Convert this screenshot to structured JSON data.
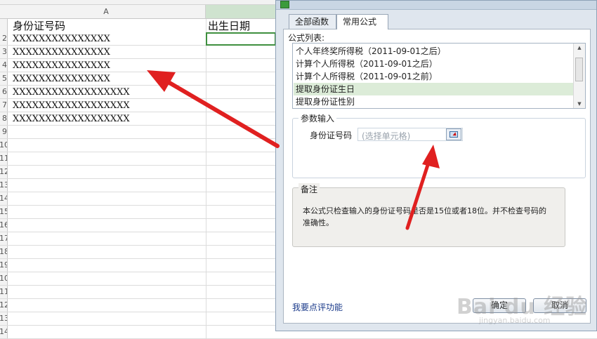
{
  "spreadsheet": {
    "column_a_label": "A",
    "column_a_header": "身份证号码",
    "column_b_header": "出生日期",
    "row_numbers": [
      "2",
      "3",
      "4",
      "5",
      "6",
      "7",
      "8",
      "9",
      "10",
      "11",
      "12",
      "13",
      "14",
      "15",
      "16",
      "17",
      "18",
      "19",
      "10",
      "11",
      "12",
      "13",
      "14"
    ],
    "id_values": [
      "XXXXXXXXXXXXXXX",
      "XXXXXXXXXXXXXXX",
      "XXXXXXXXXXXXXXX",
      "XXXXXXXXXXXXXXX",
      "XXXXXXXXXXXXXXXXXX",
      "XXXXXXXXXXXXXXXXXX",
      "XXXXXXXXXXXXXXXXXX"
    ]
  },
  "dialog": {
    "tabs": [
      {
        "label": "全部函数",
        "active": false
      },
      {
        "label": "常用公式",
        "active": true
      }
    ],
    "formula_list_label": "公式列表:",
    "formulas": [
      {
        "label": "个人年终奖所得税（2011-09-01之后）",
        "selected": false
      },
      {
        "label": "计算个人所得税（2011-09-01之后）",
        "selected": false
      },
      {
        "label": "计算个人所得税（2011-09-01之前）",
        "selected": false
      },
      {
        "label": "提取身份证生日",
        "selected": true
      },
      {
        "label": "提取身份证性别",
        "selected": false
      }
    ],
    "param_title": "参数输入",
    "param_label": "身份证号码",
    "param_placeholder": "(选择单元格)",
    "notes_title": "备注",
    "notes_text": "本公式只检查输入的身份证号码是否是15位或者18位。并不检查号码的准确性。",
    "review_link": "我要点评功能",
    "ok_button": "确定",
    "cancel_button": "取消"
  },
  "watermark": {
    "logo_text": "Bai du 经验",
    "sub_text": "jingyan.baidu.com"
  },
  "colors": {
    "selection_border": "#3f8f3f",
    "selected_formula_bg": "#dcecd8",
    "annotation_arrow": "#e02020",
    "link": "#1a3a8a"
  }
}
